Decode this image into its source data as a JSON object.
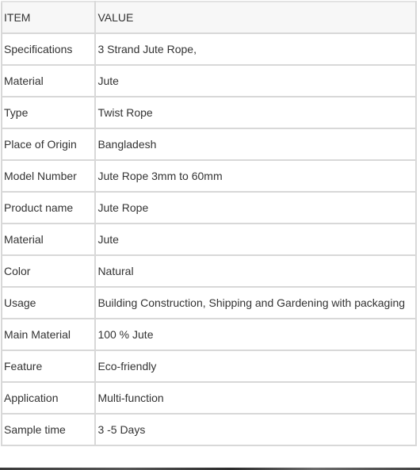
{
  "table": {
    "headers": [
      "ITEM",
      "VALUE"
    ],
    "rows": [
      [
        "Specifications",
        "3 Strand Jute Rope,"
      ],
      [
        "Material",
        "Jute"
      ],
      [
        "Type",
        "Twist Rope"
      ],
      [
        "Place of Origin",
        "Bangladesh"
      ],
      [
        "Model Number",
        "Jute Rope 3mm to 60mm"
      ],
      [
        "Product name",
        "Jute Rope"
      ],
      [
        "Material",
        "Jute"
      ],
      [
        "Color",
        "Natural"
      ],
      [
        "Usage",
        "Building Construction, Shipping and Gardening with packaging"
      ],
      [
        "Main Material",
        "100 % Jute"
      ],
      [
        "Feature",
        "Eco-friendly"
      ],
      [
        "Application",
        "Multi-function"
      ],
      [
        "Sample time",
        "3 -5 Days"
      ]
    ]
  },
  "colors": {
    "border": "#d8d8d8",
    "text": "#333333",
    "background": "#ffffff"
  }
}
